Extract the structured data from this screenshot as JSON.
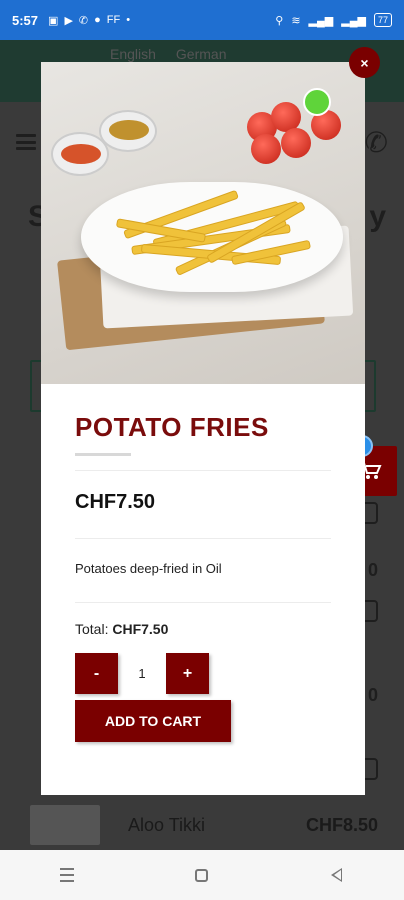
{
  "status_bar": {
    "time": "5:57",
    "left_icons": [
      "notification-icon",
      "youtube-icon",
      "whatsapp-icon",
      "messenger-icon",
      "ff-icon"
    ],
    "ff_label": "FF",
    "dot": "•",
    "battery": "77"
  },
  "background": {
    "languages": [
      "English",
      "German"
    ],
    "title_left": "S",
    "title_right": "y",
    "prices": [
      "0",
      "0",
      "0"
    ],
    "bottom_item": {
      "name": "Aloo Tikki",
      "price": "CHF8.50"
    }
  },
  "cart": {
    "count": "0"
  },
  "modal": {
    "close_label": "×",
    "title": "POTATO FRIES",
    "price": "CHF7.50",
    "description": "Potatoes deep-fried in Oil",
    "total_label": "Total:",
    "total_value": "CHF7.50",
    "qty_minus": "-",
    "qty_value": "1",
    "qty_plus": "+",
    "add_to_cart": "ADD TO CART"
  },
  "colors": {
    "brand": "#7a0000",
    "title_red": "#7a0c0c",
    "status_bar": "#1f6fd1",
    "badge_blue": "#2b8fe8"
  }
}
